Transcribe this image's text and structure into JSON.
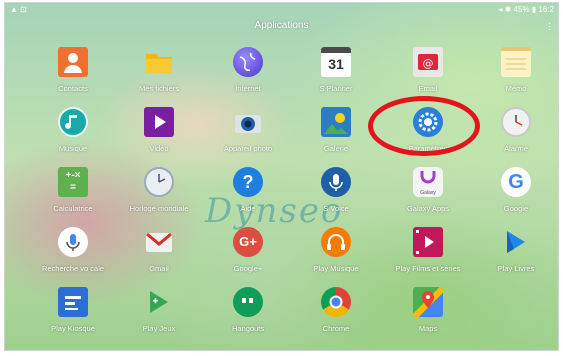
{
  "status_bar": {
    "left": "▲ ⊡",
    "right": "◂ ✱ 45% ▮ 16:2"
  },
  "title": "Applications",
  "watermark": "Dynseo",
  "apps": [
    {
      "name": "contacts",
      "label": "Contacts"
    },
    {
      "name": "mes-fichiers",
      "label": "Mes fichiers"
    },
    {
      "name": "internet",
      "label": "Internet"
    },
    {
      "name": "splanner",
      "label": "S Planner",
      "icon_text": "31"
    },
    {
      "name": "email",
      "label": "Email"
    },
    {
      "name": "memo",
      "label": "Mémo"
    },
    {
      "name": "musique",
      "label": "Musique"
    },
    {
      "name": "video",
      "label": "Vidéo"
    },
    {
      "name": "appareil-photo",
      "label": "Appareil photo"
    },
    {
      "name": "galerie",
      "label": "Galerie"
    },
    {
      "name": "parametres",
      "label": "Paramètres"
    },
    {
      "name": "alarme",
      "label": "Alarme"
    },
    {
      "name": "calculatrice",
      "label": "Calculatrice",
      "icon_text": "+-×="
    },
    {
      "name": "horloge-mondiale",
      "label": "Horloge mondiale"
    },
    {
      "name": "aide",
      "label": "Aide",
      "icon_text": "?"
    },
    {
      "name": "s-voice",
      "label": "S Voice"
    },
    {
      "name": "galaxy-apps",
      "label": "Galaxy Apps",
      "icon_text": "Galaxy"
    },
    {
      "name": "google",
      "label": "Google",
      "icon_text": "G"
    },
    {
      "name": "recherche-vocale",
      "label": "Recherche vo cale"
    },
    {
      "name": "gmail",
      "label": "Gmail"
    },
    {
      "name": "google-plus",
      "label": "Google+",
      "icon_text": "G+"
    },
    {
      "name": "play-musique",
      "label": "Play Musique"
    },
    {
      "name": "play-films",
      "label": "Play Films et séries"
    },
    {
      "name": "play-livres",
      "label": "Play Livres"
    },
    {
      "name": "play-kiosque",
      "label": "Play Kiosque"
    },
    {
      "name": "play-jeux",
      "label": "Play Jeux"
    },
    {
      "name": "hangouts",
      "label": "Hangouts"
    },
    {
      "name": "chrome",
      "label": "Chrome"
    },
    {
      "name": "maps",
      "label": "Maps"
    }
  ],
  "colors": {
    "highlight": "#e3151a"
  }
}
